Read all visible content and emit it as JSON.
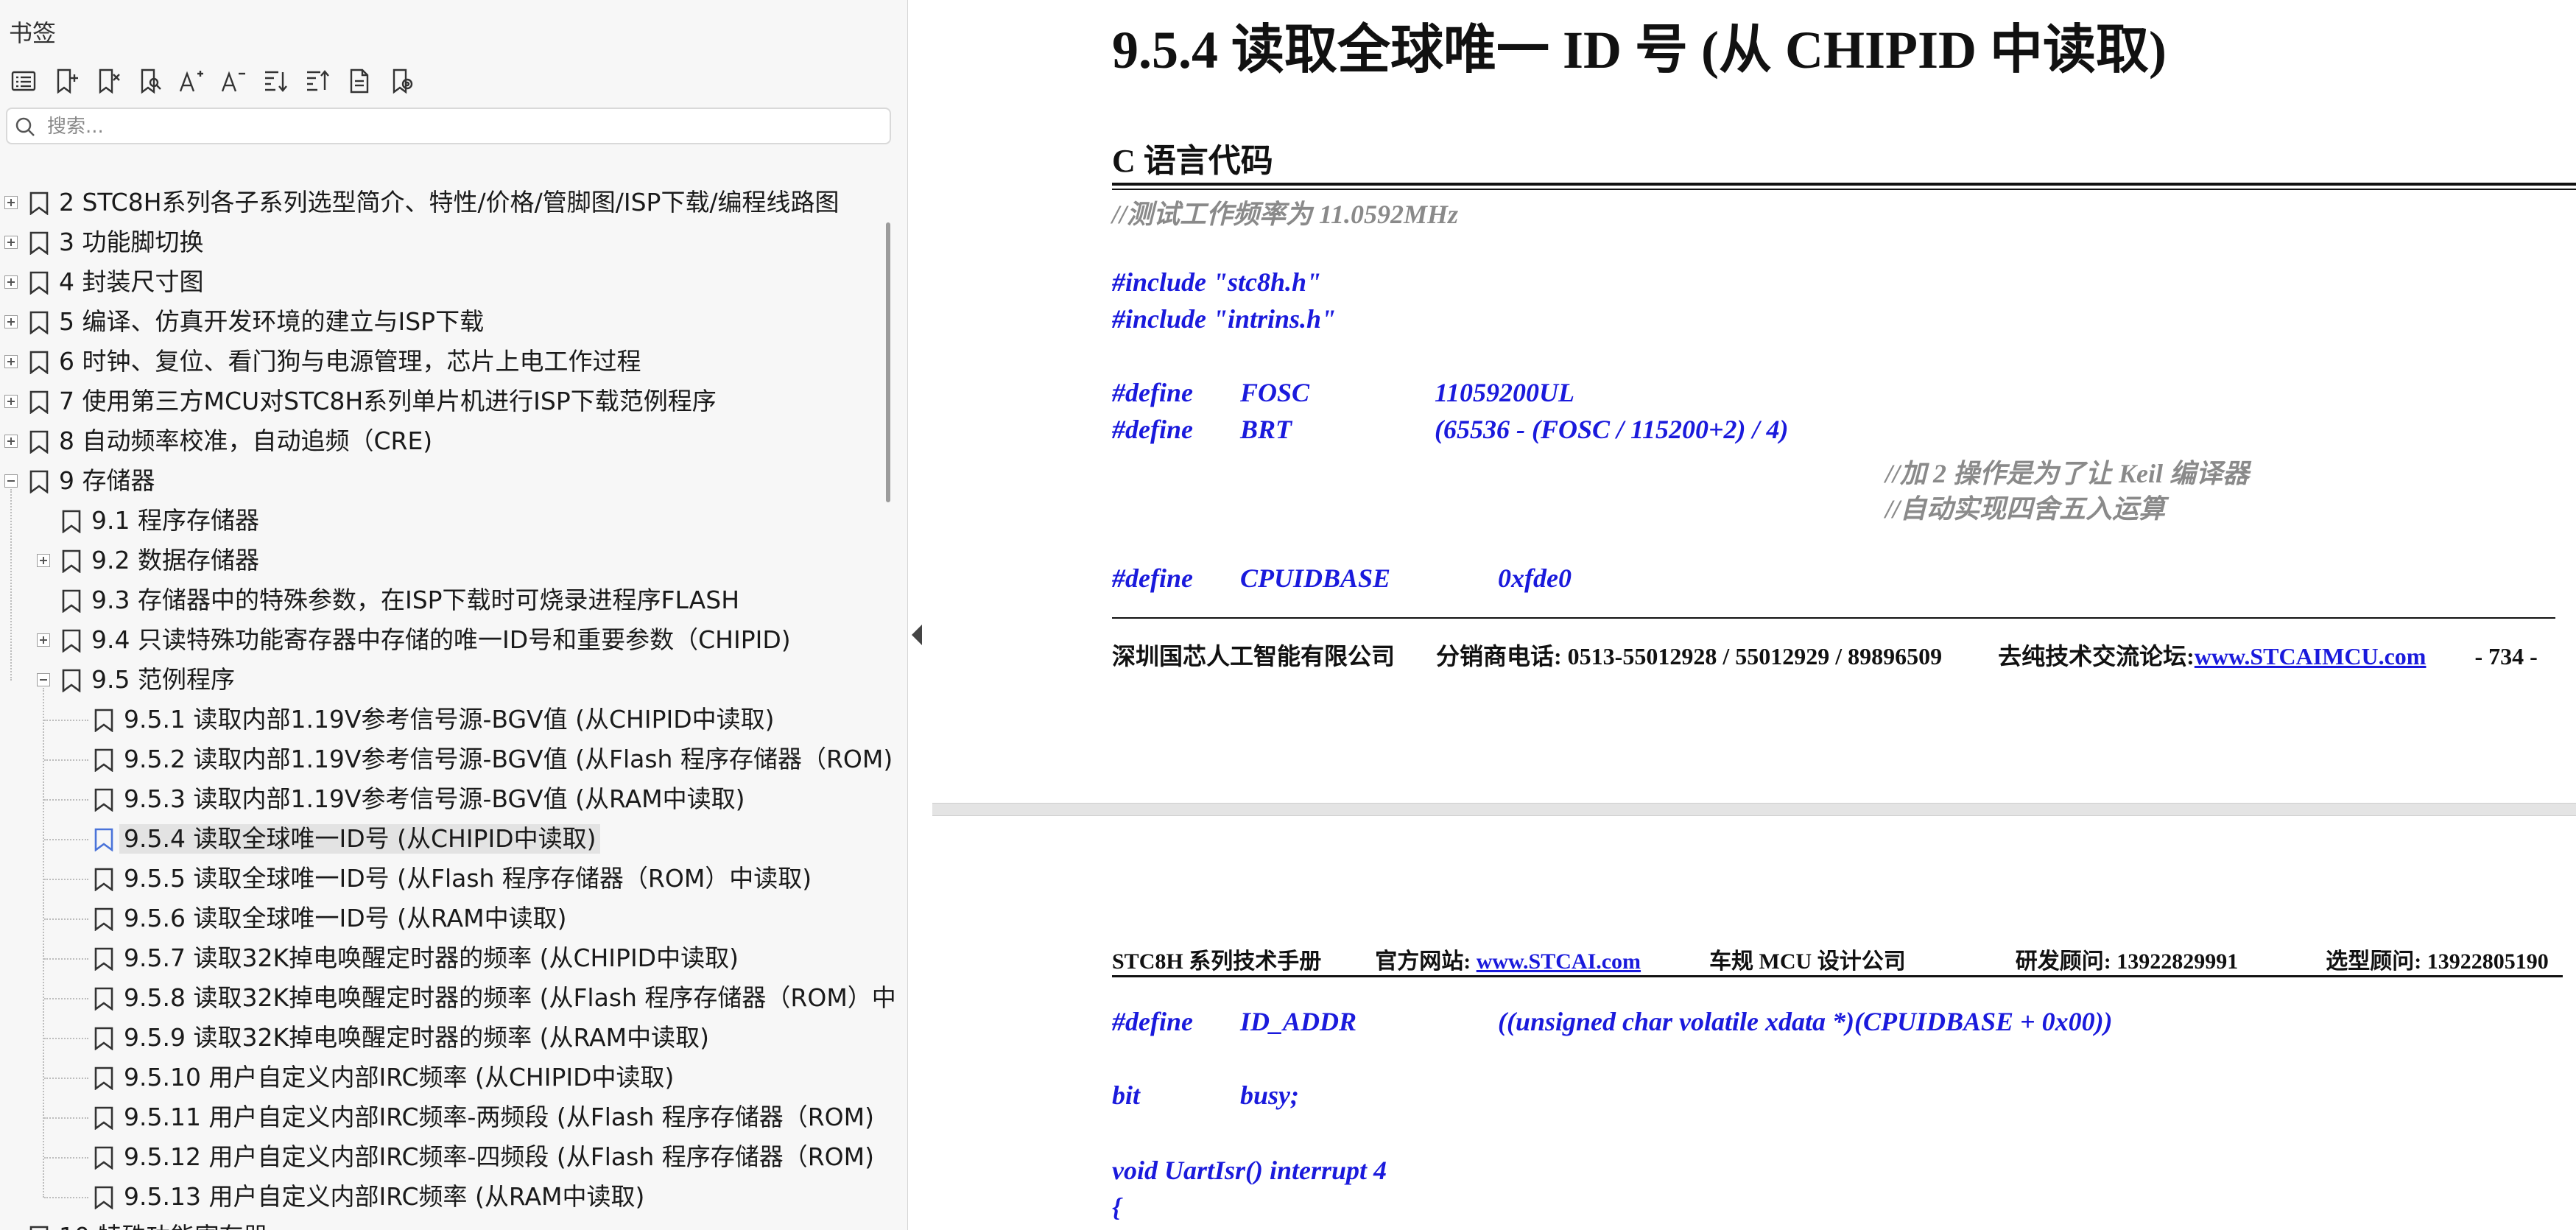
{
  "sidebar": {
    "title": "书签",
    "toolbar_icons": [
      "list-icon",
      "bookmark-add-icon",
      "bookmark-delete-icon",
      "bookmark-find-icon",
      "font-increase-icon",
      "font-decrease-icon",
      "expand-all-icon",
      "collapse-all-icon",
      "bookmark-properties-icon",
      "bookmark-settings-icon"
    ],
    "search_placeholder": "搜索...",
    "items": [
      {
        "level": 0,
        "expander": "plus",
        "label": "2  STC8H系列各子系列选型简介、特性/价格/管脚图/ISP下载/编程线路图"
      },
      {
        "level": 0,
        "expander": "plus",
        "label": "3  功能脚切换"
      },
      {
        "level": 0,
        "expander": "plus",
        "label": "4  封装尺寸图"
      },
      {
        "level": 0,
        "expander": "plus",
        "label": "5  编译、仿真开发环境的建立与ISP下载"
      },
      {
        "level": 0,
        "expander": "plus",
        "label": "6  时钟、复位、看门狗与电源管理，芯片上电工作过程"
      },
      {
        "level": 0,
        "expander": "plus",
        "label": "7  使用第三方MCU对STC8H系列单片机进行ISP下载范例程序"
      },
      {
        "level": 0,
        "expander": "plus",
        "label": "8  自动频率校准，自动追频（CRE)"
      },
      {
        "level": 0,
        "expander": "minus",
        "label": "9  存储器"
      },
      {
        "level": 1,
        "expander": "none",
        "label": "9.1 程序存储器"
      },
      {
        "level": 1,
        "expander": "plus",
        "label": "9.2  数据存储器"
      },
      {
        "level": 1,
        "expander": "none",
        "label": "9.3  存储器中的特殊参数，在ISP下载时可烧录进程序FLASH"
      },
      {
        "level": 1,
        "expander": "plus",
        "label": "9.4  只读特殊功能寄存器中存储的唯一ID号和重要参数（CHIPID)"
      },
      {
        "level": 1,
        "expander": "minus",
        "label": "9.5  范例程序"
      },
      {
        "level": 2,
        "expander": "none",
        "label": "9.5.1 读取内部1.19V参考信号源-BGV值 (从CHIPID中读取)"
      },
      {
        "level": 2,
        "expander": "none",
        "label": "9.5.2 读取内部1.19V参考信号源-BGV值 (从Flash 程序存储器（ROM)"
      },
      {
        "level": 2,
        "expander": "none",
        "label": "9.5.3 读取内部1.19V参考信号源-BGV值 (从RAM中读取)"
      },
      {
        "level": 2,
        "expander": "none",
        "label": "9.5.4 读取全球唯一ID号 (从CHIPID中读取)",
        "selected": true
      },
      {
        "level": 2,
        "expander": "none",
        "label": "9.5.5 读取全球唯一ID号 (从Flash 程序存储器（ROM）中读取)"
      },
      {
        "level": 2,
        "expander": "none",
        "label": "9.5.6 读取全球唯一ID号 (从RAM中读取)"
      },
      {
        "level": 2,
        "expander": "none",
        "label": "9.5.7 读取32K掉电唤醒定时器的频率 (从CHIPID中读取)"
      },
      {
        "level": 2,
        "expander": "none",
        "label": "9.5.8 读取32K掉电唤醒定时器的频率 (从Flash 程序存储器（ROM）中"
      },
      {
        "level": 2,
        "expander": "none",
        "label": "9.5.9 读取32K掉电唤醒定时器的频率 (从RAM中读取)"
      },
      {
        "level": 2,
        "expander": "none",
        "label": "9.5.10 用户自定义内部IRC频率 (从CHIPID中读取)"
      },
      {
        "level": 2,
        "expander": "none",
        "label": "9.5.11 用户自定义内部IRC频率-两频段 (从Flash 程序存储器（ROM)"
      },
      {
        "level": 2,
        "expander": "none",
        "label": "9.5.12 用户自定义内部IRC频率-四频段 (从Flash 程序存储器（ROM)"
      },
      {
        "level": 2,
        "expander": "none",
        "label": "9.5.13 用户自定义内部IRC频率 (从RAM中读取)"
      },
      {
        "level": 0,
        "expander": "plus",
        "label": "10  特殊功能寄存器"
      }
    ]
  },
  "doc": {
    "heading": "9.5.4    读取全球唯一 ID 号  (从 CHIPID 中读取)",
    "subheading": "C 语言代码",
    "comment_freq": "//测试工作频率为 11.0592MHz",
    "include1": "#include \"stc8h.h\"",
    "include2": "#include \"intrins.h\"",
    "define_kw": "#define",
    "fosc_name": "FOSC",
    "fosc_val": "11059200UL",
    "brt_name": "BRT",
    "brt_val": "(65536 - (FOSC / 115200+2) / 4)",
    "comment_keil1": "//加 2 操作是为了让 Keil 编译器",
    "comment_keil2": "//自动实现四舍五入运算",
    "cpuidbase_name": "CPUIDBASE",
    "cpuidbase_val": "0xfde0",
    "footer_company": "深圳国芯人工智能有限公司",
    "footer_phone": "分销商电话: 0513-55012928 / 55012929 / 89896509",
    "footer_forum_label": "去纯技术交流论坛:",
    "footer_forum_link": "www.STCAIMCU.com",
    "footer_page": "- 734 -",
    "header_manual": "STC8H 系列技术手册",
    "header_site_label": "官方网站: ",
    "header_site_link": "www.STCAI.com",
    "header_designer": "车规 MCU 设计公司",
    "header_rd": "研发顾问: 13922829991",
    "header_sel": "选型顾问: 13922805190",
    "id_addr_name": "ID_ADDR",
    "id_addr_val": "((unsigned char volatile xdata *)(CPUIDBASE + 0x00))",
    "bit_kw": "bit",
    "bit_var": "busy;",
    "isr_line": "void UartIsr() interrupt 4",
    "brace": "{"
  }
}
